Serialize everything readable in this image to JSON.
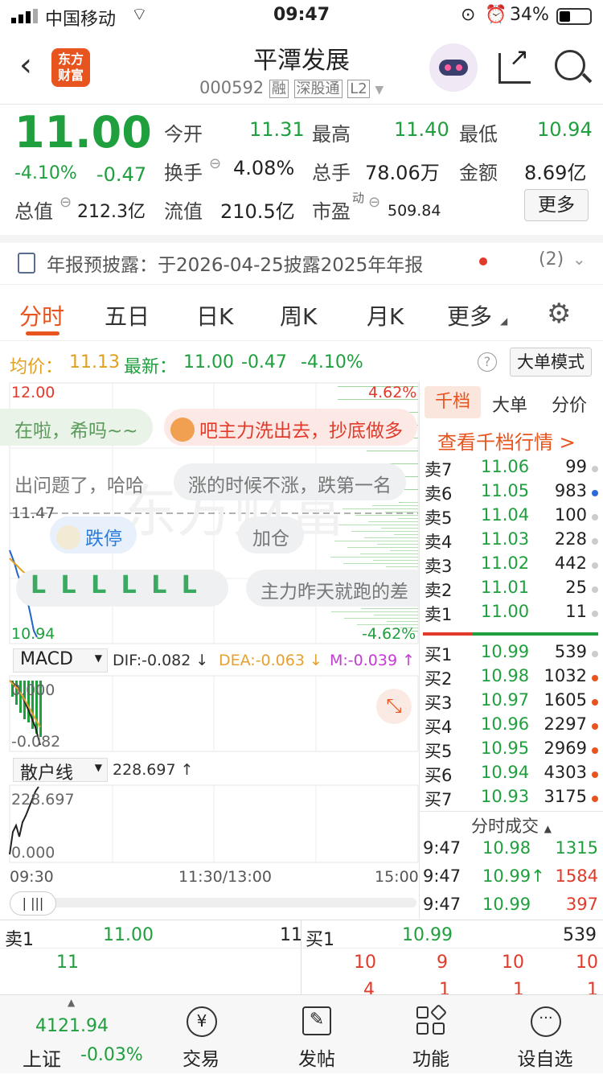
{
  "status": {
    "carrier": "中国移动",
    "time": "09:47",
    "battery": "34%"
  },
  "header": {
    "logo_line1": "东方",
    "logo_line2": "财富",
    "title": "平潭发展",
    "code": "000592",
    "tags": [
      "融",
      "深股通",
      "L2"
    ]
  },
  "quote": {
    "price": "11.00",
    "pct": "-4.10%",
    "chg": "-0.47",
    "open_label": "今开",
    "open": "11.31",
    "high_label": "最高",
    "high": "11.40",
    "low_label": "最低",
    "low": "10.94",
    "turnover_label": "换手",
    "turnover": "4.08%",
    "vol_label": "总手",
    "vol": "78.06万",
    "amount_label": "金额",
    "amount": "8.69亿",
    "mcap_label": "总值",
    "mcap": "212.3亿",
    "fcap_label": "流值",
    "fcap": "210.5亿",
    "pe_label": "市盈",
    "pe_sup": "动",
    "pe": "509.84",
    "more": "更多"
  },
  "notice": {
    "text": "年报预披露：于2026-04-25披露2025年年报",
    "count": "(2)"
  },
  "tabs": [
    "分时",
    "五日",
    "日K",
    "周K",
    "月K",
    "更多"
  ],
  "info": {
    "avg_label": "均价：",
    "avg": "11.13",
    "last_label": "最新：",
    "last": "11.00",
    "chg": "-0.47",
    "pct": "-4.10%",
    "mode_btn": "大单模式"
  },
  "chart": {
    "y_top": "12.00",
    "y_bottom": "10.94",
    "pct_top": "4.62%",
    "pct_bottom": "-4.62%",
    "ref": "11.47",
    "watermark": "东方财富",
    "bubbles": [
      "在啦，希吗~~",
      "吧主力洗出去，抄底做多",
      "出问题了，哈哈",
      "涨的时候不涨，跌第一名",
      "跌停",
      "加仓",
      "主力昨天就跑的差"
    ],
    "macd_label": "MACD",
    "dif": "DIF:-0.082 ↓",
    "dea": "DEA:-0.063 ↓",
    "m": "M:-0.039 ↑",
    "macd_top": "0.000",
    "macd_bottom": "-0.082",
    "sh_label": "散户线",
    "sh_val": "228.697 ↑",
    "sh_top": "228.697",
    "sh_bottom": "0.000",
    "t_start": "09:30",
    "t_mid": "11:30/13:00",
    "t_end": "15:00"
  },
  "orderbook": {
    "tabs": [
      "千档",
      "大单",
      "分价"
    ],
    "link": "查看千档行情 >",
    "asks": [
      {
        "l": "卖7",
        "p": "11.06",
        "v": "99"
      },
      {
        "l": "卖6",
        "p": "11.05",
        "v": "983"
      },
      {
        "l": "卖5",
        "p": "11.04",
        "v": "100"
      },
      {
        "l": "卖4",
        "p": "11.03",
        "v": "228"
      },
      {
        "l": "卖3",
        "p": "11.02",
        "v": "442"
      },
      {
        "l": "卖2",
        "p": "11.01",
        "v": "25"
      },
      {
        "l": "卖1",
        "p": "11.00",
        "v": "11"
      }
    ],
    "bids": [
      {
        "l": "买1",
        "p": "10.99",
        "v": "539"
      },
      {
        "l": "买2",
        "p": "10.98",
        "v": "1032"
      },
      {
        "l": "买3",
        "p": "10.97",
        "v": "1605"
      },
      {
        "l": "买4",
        "p": "10.96",
        "v": "2297"
      },
      {
        "l": "买5",
        "p": "10.95",
        "v": "2969"
      },
      {
        "l": "买6",
        "p": "10.94",
        "v": "4303"
      },
      {
        "l": "买7",
        "p": "10.93",
        "v": "3175"
      }
    ],
    "trades_label": "分时成交",
    "trades": [
      {
        "t": "9:47",
        "p": "10.98",
        "v": "1315"
      },
      {
        "t": "9:47",
        "p": "10.99↑",
        "v": "1584"
      },
      {
        "t": "9:47",
        "p": "10.99",
        "v": "397"
      }
    ]
  },
  "queue": {
    "ask_label": "卖1",
    "ask_price": "11.00",
    "ask_vol": "11",
    "bid_label": "买1",
    "bid_price": "10.99",
    "bid_vol": "539",
    "ask_row": [
      "11"
    ],
    "bid_row1": [
      "10",
      "9",
      "10",
      "10"
    ],
    "bid_row2": [
      "4",
      "1",
      "1",
      "1"
    ]
  },
  "bottom": {
    "index_val": "4121.94",
    "index_name": "上证",
    "index_pct": "-0.03%",
    "items": [
      "交易",
      "发帖",
      "功能",
      "设自选"
    ]
  },
  "colors": {
    "up": "#e23a2a",
    "down": "#1f9f3d",
    "accent": "#e8541e"
  }
}
